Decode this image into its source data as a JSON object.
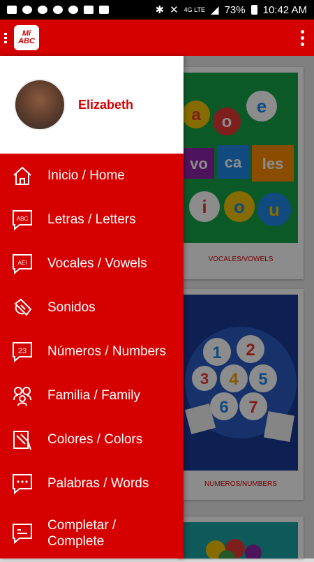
{
  "status_bar": {
    "battery": "73%",
    "time": "10:42 AM",
    "network": "4G LTE"
  },
  "app": {
    "logo_text_top": "Mi",
    "logo_text_bottom": "ABC",
    "accent_color": "#d50000"
  },
  "cards": [
    {
      "caption": "VOCALES/VOWELS",
      "art_text": [
        "a",
        "o",
        "e",
        "vo",
        "ca",
        "les",
        "i",
        "o",
        "u"
      ]
    },
    {
      "caption": "NUMEROS/NUMBERS",
      "art_text": [
        "1",
        "2",
        "3",
        "4",
        "5",
        "6",
        "7"
      ]
    }
  ],
  "drawer": {
    "user_name": "Elizabeth",
    "items": [
      {
        "label": "Inicio / Home",
        "icon": "home-icon"
      },
      {
        "label": "Letras / Letters",
        "icon": "abc-letters-icon"
      },
      {
        "label": "Vocales / Vowels",
        "icon": "aei-vowels-icon"
      },
      {
        "label": "Sonidos",
        "icon": "sound-icon"
      },
      {
        "label": "Números / Numbers",
        "icon": "numbers-icon"
      },
      {
        "label": "Familia / Family",
        "icon": "family-icon"
      },
      {
        "label": "Colores / Colors",
        "icon": "colors-icon"
      },
      {
        "label": "Palabras / Words",
        "icon": "words-icon"
      },
      {
        "label": "Completar / Complete",
        "icon": "complete-icon"
      }
    ]
  }
}
